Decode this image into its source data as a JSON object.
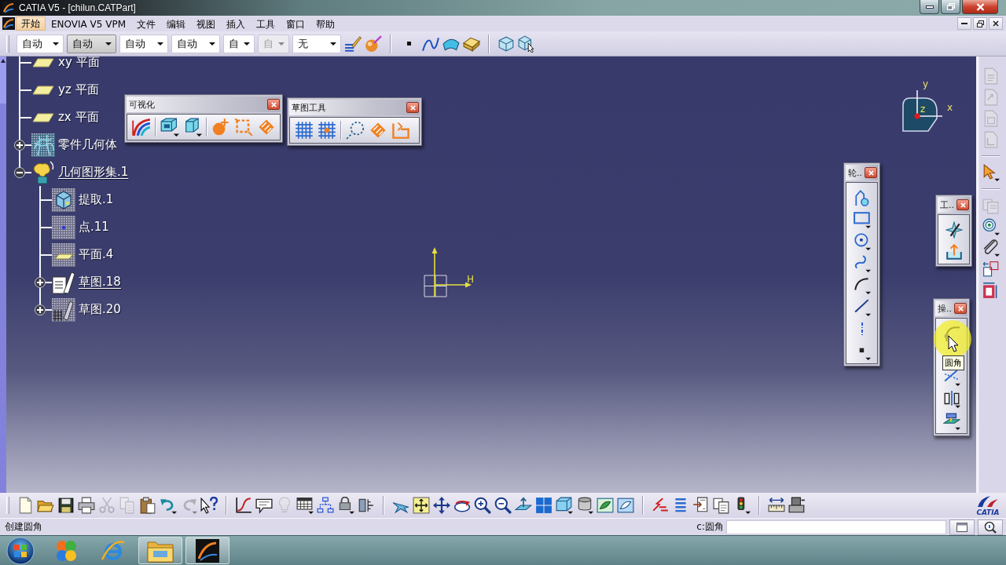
{
  "window": {
    "title": "CATIA V5 - [chilun.CATPart]"
  },
  "menu": [
    {
      "label": "开始",
      "selected": true
    },
    {
      "label": "ENOVIA V5 VPM",
      "selected": false
    },
    {
      "label": "文件",
      "selected": false
    },
    {
      "label": "编辑",
      "selected": false
    },
    {
      "label": "视图",
      "selected": false
    },
    {
      "label": "插入",
      "selected": false
    },
    {
      "label": "工具",
      "selected": false
    },
    {
      "label": "窗口",
      "selected": false
    },
    {
      "label": "帮助",
      "selected": false
    }
  ],
  "toolbar": {
    "combos": [
      {
        "value": "自动",
        "pressed": false,
        "disabled": false
      },
      {
        "value": "自动",
        "pressed": true,
        "disabled": false
      },
      {
        "value": "自动",
        "pressed": false,
        "disabled": false
      },
      {
        "value": "自动",
        "pressed": false,
        "disabled": false
      },
      {
        "value": "自",
        "pressed": false,
        "disabled": false
      },
      {
        "value": "自",
        "pressed": false,
        "disabled": true
      },
      {
        "value": "无",
        "pressed": false,
        "disabled": false
      }
    ]
  },
  "tree": [
    {
      "label": "xy 平面",
      "kind": "plane",
      "underlined": false
    },
    {
      "label": "yz 平面",
      "kind": "plane",
      "underlined": false
    },
    {
      "label": "zx 平面",
      "kind": "plane",
      "underlined": false
    },
    {
      "label": "零件几何体",
      "kind": "body",
      "underlined": false,
      "expanded": false
    },
    {
      "label": "几何图形集.1",
      "kind": "geoset",
      "underlined": true,
      "expanded": true,
      "children": [
        {
          "label": "提取.1",
          "kind": "extract",
          "underlined": false
        },
        {
          "label": "点.11",
          "kind": "point",
          "underlined": false
        },
        {
          "label": "平面.4",
          "kind": "plane_feature",
          "underlined": false
        },
        {
          "label": "草图.18",
          "kind": "sketch",
          "underlined": true,
          "expanded": false
        },
        {
          "label": "草图.20",
          "kind": "sketch_grid",
          "underlined": false,
          "expanded": false
        }
      ]
    }
  ],
  "floating_toolbars": [
    {
      "kind": "visualization",
      "title": "可视化"
    },
    {
      "kind": "sketch_tools",
      "title": "草图工具"
    },
    {
      "kind": "profile",
      "title": "轮.."
    },
    {
      "kind": "tools",
      "title": "工.."
    },
    {
      "kind": "operation",
      "title": "操..",
      "tooltip": "圆角"
    }
  ],
  "compass": {
    "x": "x",
    "y": "y",
    "z": "z"
  },
  "sketch_axes": {
    "h_label": "H"
  },
  "right_toolbar": {
    "buttons": [
      {
        "disabled": true
      },
      {
        "disabled": true
      },
      {
        "disabled": true
      },
      {
        "disabled": true
      },
      {
        "disabled": false
      },
      {
        "disabled": true
      },
      {
        "disabled": false
      },
      {
        "disabled": false
      },
      {
        "disabled": false
      },
      {
        "disabled": false
      }
    ]
  },
  "bottom_toolbar": {
    "buttons": [
      {
        "disabled": false
      },
      {
        "disabled": false
      },
      {
        "disabled": false
      },
      {
        "disabled": false
      },
      {
        "disabled": true
      },
      {
        "disabled": true
      },
      {
        "disabled": false
      },
      {
        "disabled": false
      },
      {
        "disabled": true
      },
      {
        "disabled": false
      },
      {
        "disabled": false
      },
      {
        "disabled": false
      },
      {
        "disabled": true
      },
      {
        "disabled": false
      },
      {
        "disabled": false
      },
      {
        "disabled": false
      },
      {
        "disabled": false
      },
      {
        "disabled": false
      },
      {
        "disabled": false
      },
      {
        "disabled": false
      },
      {
        "disabled": false
      },
      {
        "disabled": false
      },
      {
        "disabled": false
      },
      {
        "disabled": false
      },
      {
        "disabled": false
      },
      {
        "disabled": false
      },
      {
        "disabled": false
      },
      {
        "disabled": false
      },
      {
        "disabled": false
      },
      {
        "disabled": false
      },
      {
        "disabled": false
      },
      {
        "disabled": false
      },
      {
        "disabled": false
      },
      {
        "disabled": false
      },
      {
        "disabled": false
      },
      {
        "disabled": false
      }
    ],
    "logo_text": "CATIA"
  },
  "status_bar": {
    "message": "创建圆角",
    "prompt_label": "c:圆角"
  },
  "taskbar": {
    "apps": [
      {
        "active": false
      },
      {
        "active": false
      },
      {
        "active": true
      },
      {
        "active": true
      }
    ]
  }
}
